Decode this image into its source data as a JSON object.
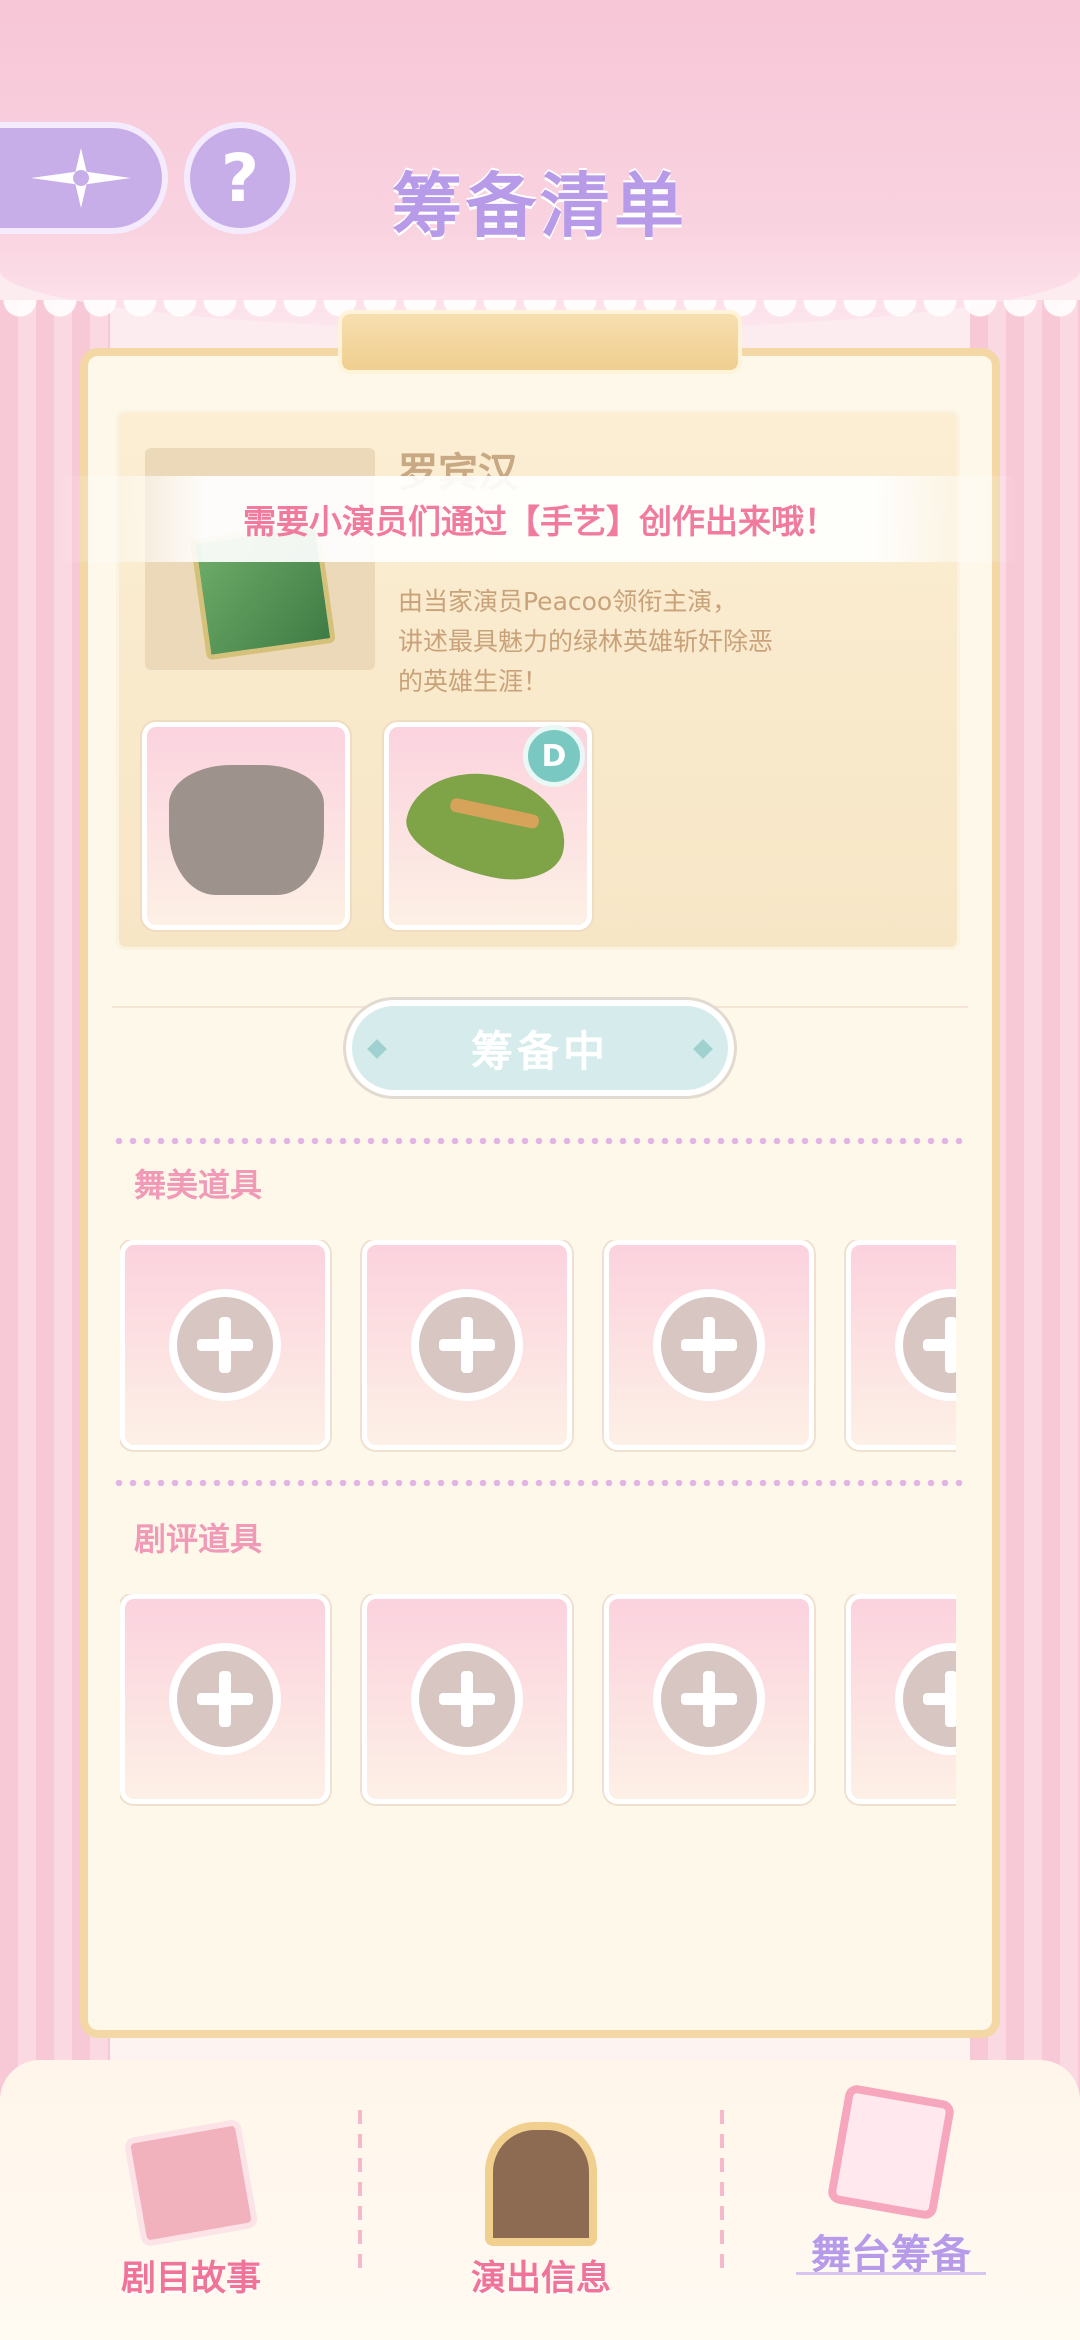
{
  "header": {
    "title": "筹备清单",
    "back_icon": "compass-arrow-icon",
    "help_label": "?"
  },
  "story": {
    "name": "罗宾汉",
    "description_lines": [
      "由当家演员Peacoo领衔主演，",
      "讲述最具魅力的绿林英雄斩奸除恶",
      "的英雄生涯！"
    ],
    "costume_slots": [
      {
        "name": "locked-top-silhouette"
      },
      {
        "name": "green-feather-hat",
        "badge": "D"
      }
    ]
  },
  "toast": {
    "text": "需要小演员们通过【手艺】创作出来哦！"
  },
  "status": {
    "label": "筹备中"
  },
  "sections": [
    {
      "title": "舞美道具",
      "slots": 4
    },
    {
      "title": "剧评道具",
      "slots": 4
    }
  ],
  "bottom_nav": {
    "items": [
      {
        "label": "剧目故事",
        "icon": "storybook-icon",
        "active": false
      },
      {
        "label": "演出信息",
        "icon": "notice-board-icon",
        "active": false
      },
      {
        "label": "舞台筹备",
        "icon": "clipboard-icon",
        "active": true
      }
    ]
  },
  "colors": {
    "title_purple": "#b79be8",
    "accent_pink": "#f07b9e",
    "panel_bg": "#fdf8ea"
  }
}
